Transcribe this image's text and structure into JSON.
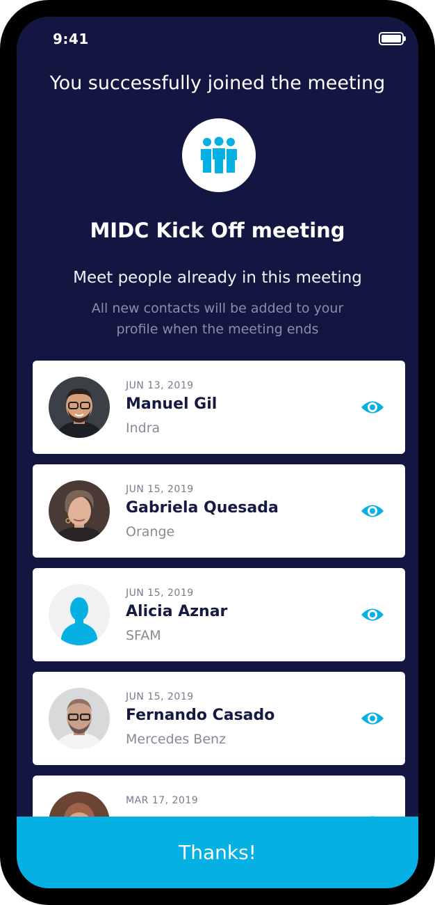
{
  "status_bar": {
    "time": "9:41",
    "battery_icon": "battery-full-icon"
  },
  "header": {
    "title": "You successfully joined the meeting",
    "badge_icon": "group-icon"
  },
  "meeting": {
    "name": "MIDC Kick Off meeting",
    "subtitle": "Meet people already in this meeting",
    "note": "All new contacts will be added to your profile when the meeting ends"
  },
  "contacts": [
    {
      "date": "JUN 13, 2019",
      "name": "Manuel Gil",
      "company": "Indra",
      "avatar": "photo"
    },
    {
      "date": "JUN 15, 2019",
      "name": "Gabriela Quesada",
      "company": "Orange",
      "avatar": "photo"
    },
    {
      "date": "JUN 15, 2019",
      "name": "Alicia Aznar",
      "company": "SFAM",
      "avatar": "placeholder"
    },
    {
      "date": "JUN 15, 2019",
      "name": "Fernando Casado",
      "company": "Mercedes Benz",
      "avatar": "photo"
    },
    {
      "date": "MAR 17, 2019",
      "name": "",
      "company": "",
      "avatar": "photo"
    }
  ],
  "action_icon": "eye-icon",
  "footer": {
    "thanks_label": "Thanks!"
  },
  "colors": {
    "background": "#121641",
    "accent": "#05b0e2",
    "card": "#ffffff",
    "name_text": "#151a42"
  }
}
